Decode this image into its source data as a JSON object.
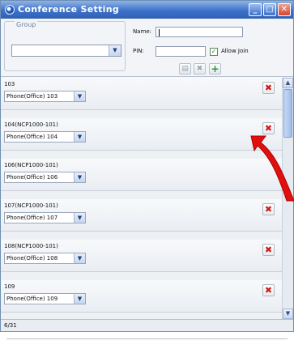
{
  "window": {
    "title": "Conference Setting",
    "title_icon": "app-icon",
    "buttons": {
      "minimize": "_",
      "maximize": "□",
      "close": "✕"
    }
  },
  "group": {
    "legend": "Group",
    "selected": ""
  },
  "form": {
    "name_label": "Name:",
    "name_value": "",
    "pin_label": "PIN:",
    "pin_value": "",
    "allow_join_label": "Allow Join",
    "allow_join_checked": true
  },
  "toolbar": {
    "save_icon": "save-icon",
    "delete_icon": "delete-icon",
    "add_icon": "add-icon",
    "save_glyph": "▤",
    "delete_glyph": "✖",
    "add_glyph": "+"
  },
  "rows": [
    {
      "label": "103",
      "combo": "Phone(Office) 103",
      "delete_glyph": "✖"
    },
    {
      "label": "104(NCP1000-101)",
      "combo": "Phone(Office) 104",
      "delete_glyph": "✖"
    },
    {
      "label": "106(NCP1000-101)",
      "combo": "Phone(Office) 106",
      "delete_glyph": ""
    },
    {
      "label": "107(NCP1000-101)",
      "combo": "Phone(Office) 107",
      "delete_glyph": "✖"
    },
    {
      "label": "108(NCP1000-101)",
      "combo": "Phone(Office) 108",
      "delete_glyph": "✖"
    },
    {
      "label": "109",
      "combo": "Phone(Office) 109",
      "delete_glyph": "✖"
    }
  ],
  "status": {
    "count": "6/31"
  },
  "colors": {
    "delete": "#d01818",
    "add": "#2b9a2b",
    "annotation_arrow": "#e01010"
  },
  "glyphs": {
    "combo": "▼",
    "scroll_up": "▲",
    "scroll_down": "▼",
    "check": "✓"
  }
}
